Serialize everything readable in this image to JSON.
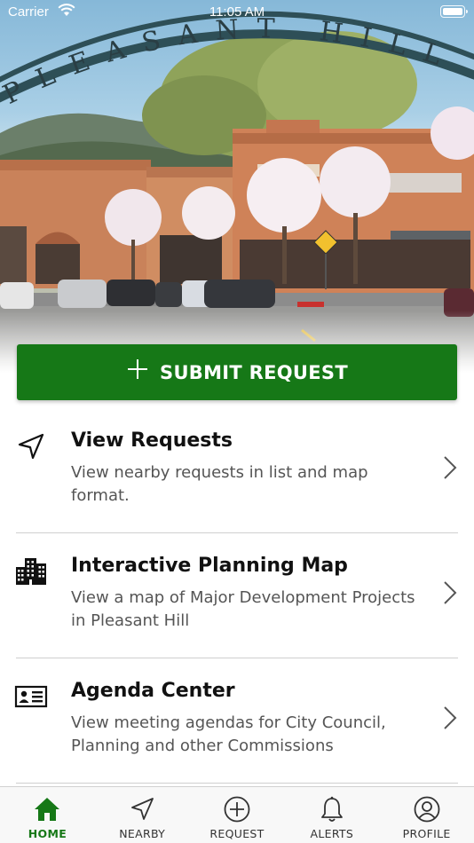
{
  "status_bar": {
    "carrier": "Carrier",
    "time": "11:05 AM"
  },
  "hero": {
    "arch_text": "PLEASANT HILL"
  },
  "submit_button": {
    "label": "SUBMIT REQUEST",
    "color": "#167817"
  },
  "menu": [
    {
      "title": "View Requests",
      "description": "View nearby requests in list and map format.",
      "icon": "navigation-arrow-icon"
    },
    {
      "title": "Interactive Planning Map",
      "description": "View a map of Major Development Projects in Pleasant Hill",
      "icon": "city-buildings-icon"
    },
    {
      "title": "Agenda Center",
      "description": "View meeting agendas for City Council, Planning and other Commissions",
      "icon": "id-card-icon"
    }
  ],
  "tab_bar": {
    "active": "HOME",
    "accent_color": "#167817",
    "tabs": [
      {
        "label": "HOME",
        "icon": "home-icon"
      },
      {
        "label": "NEARBY",
        "icon": "navigation-arrow-icon"
      },
      {
        "label": "REQUEST",
        "icon": "plus-circle-icon"
      },
      {
        "label": "ALERTS",
        "icon": "bell-icon"
      },
      {
        "label": "PROFILE",
        "icon": "user-circle-icon"
      }
    ]
  }
}
